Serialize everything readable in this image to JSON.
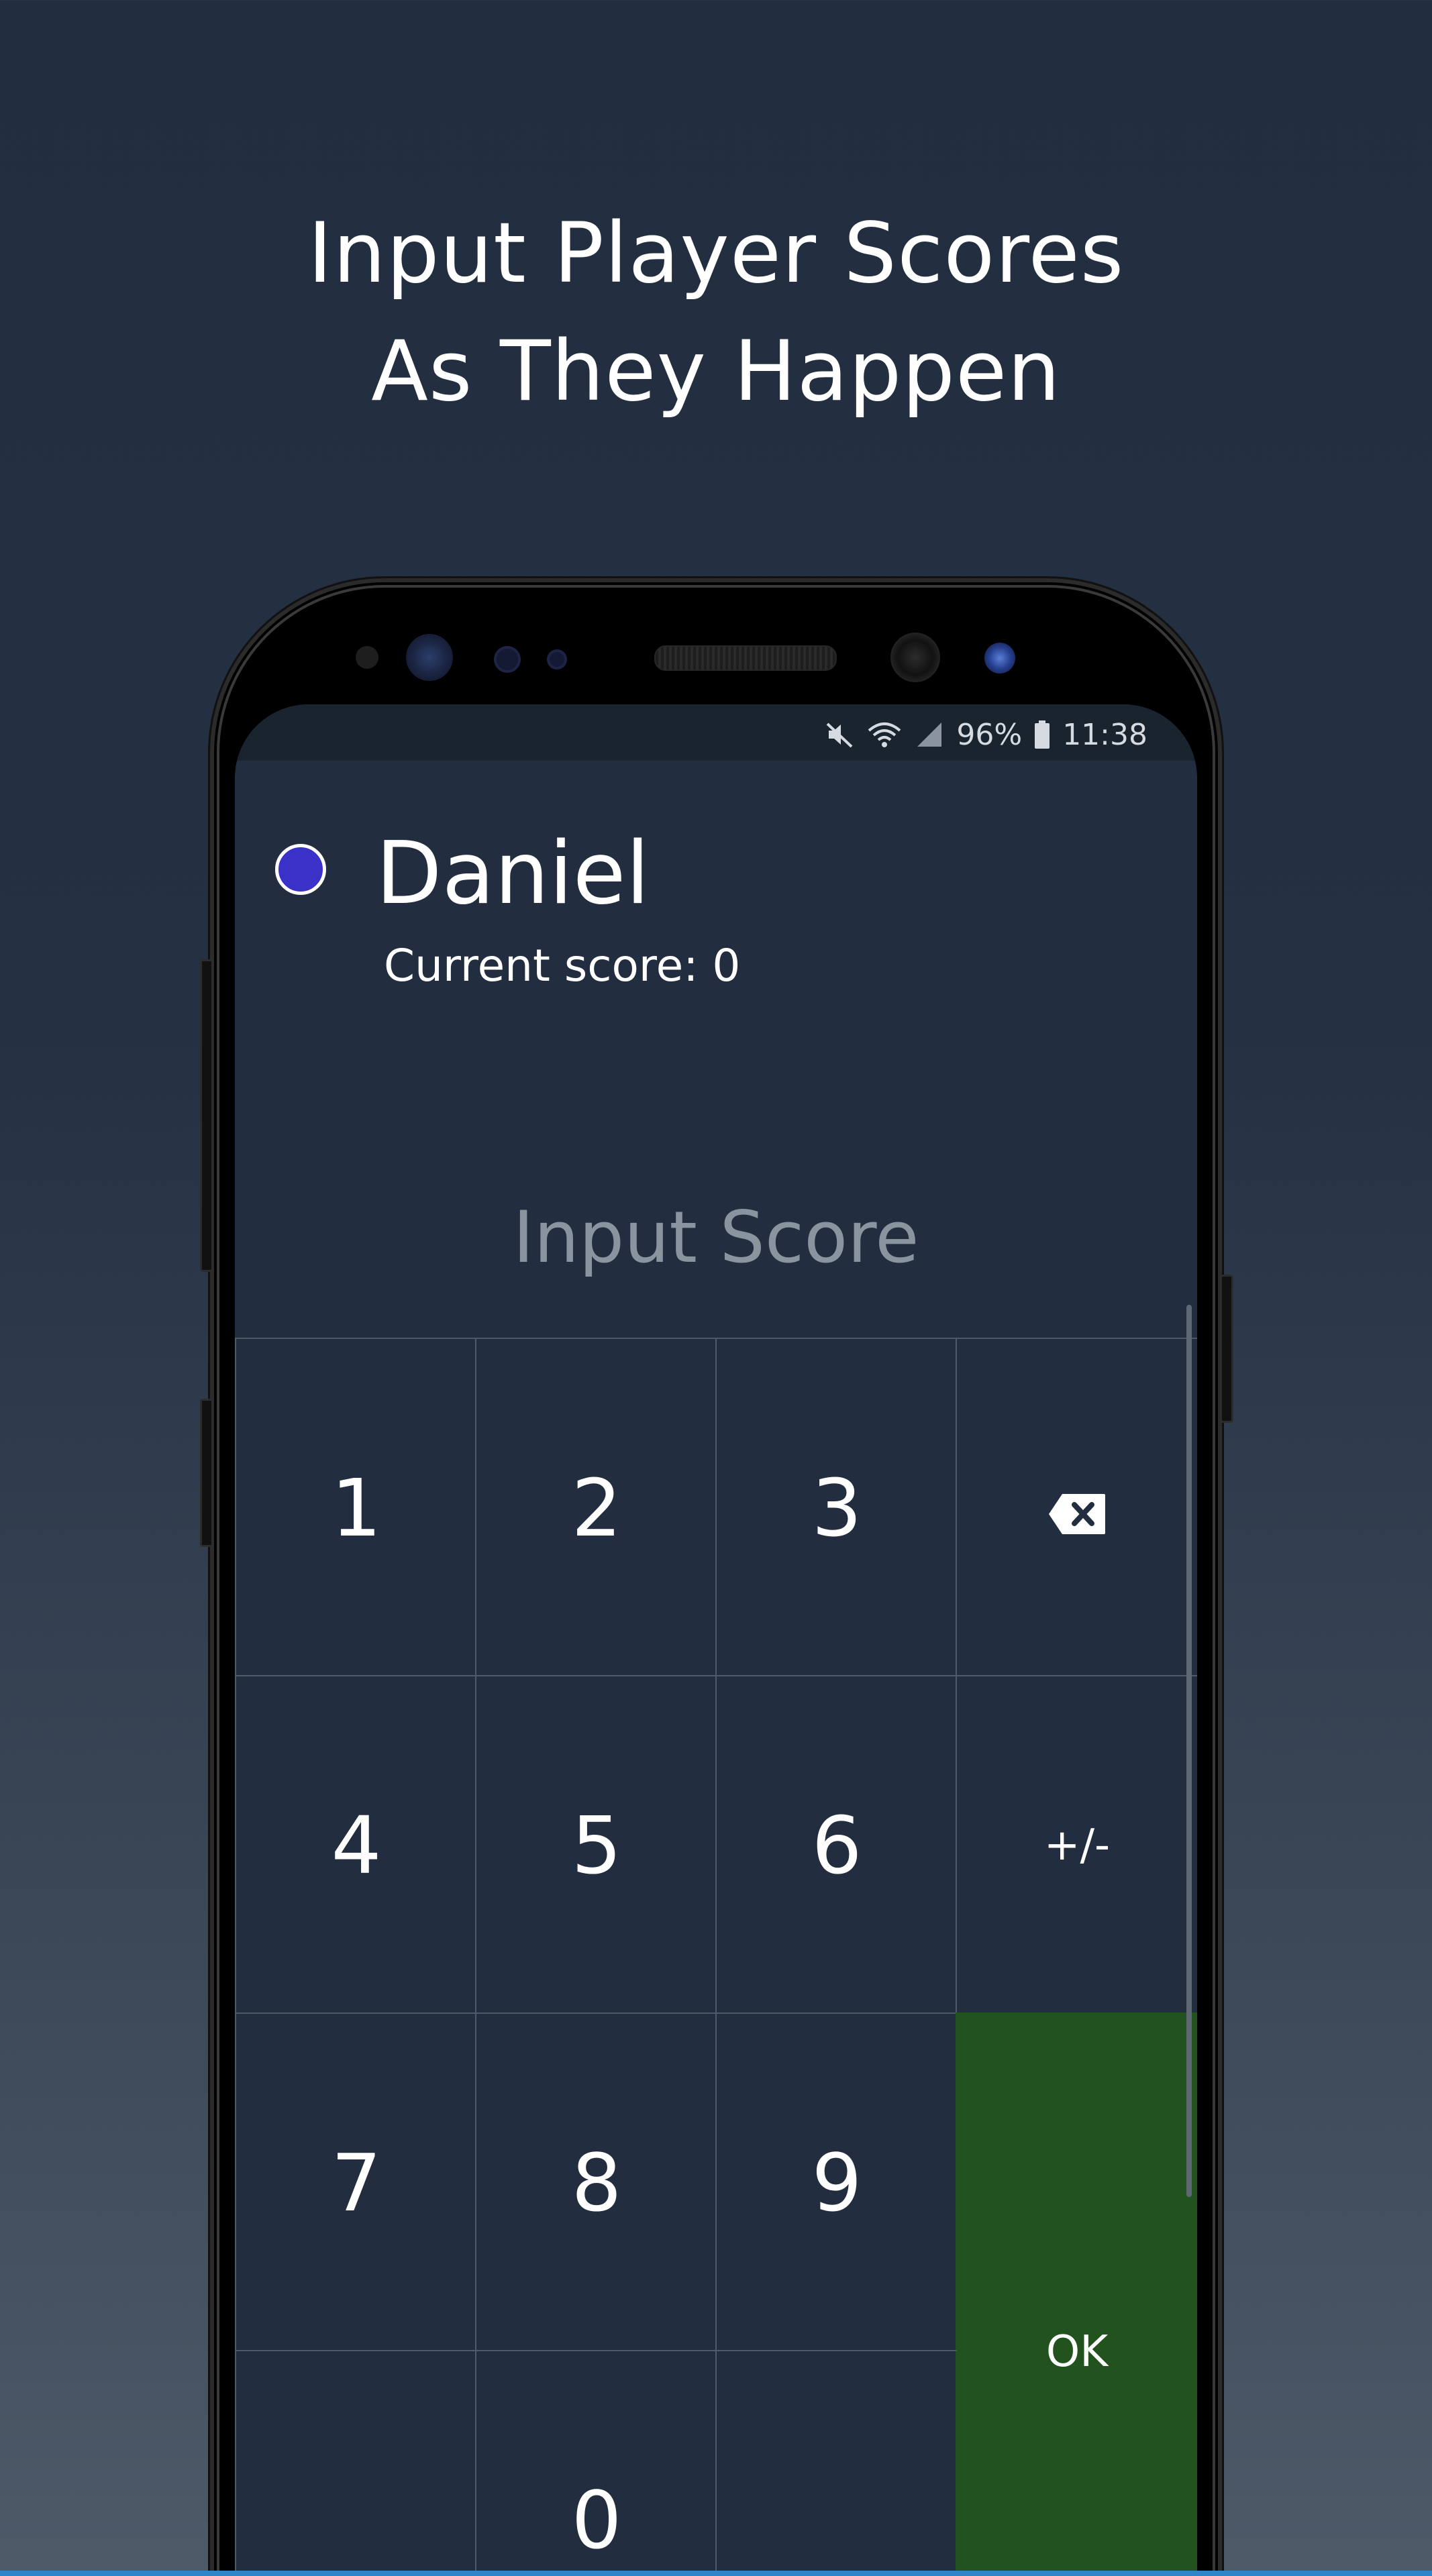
{
  "promo": {
    "title_line1": "Input Player Scores",
    "title_line2": "As They Happen"
  },
  "status_bar": {
    "icons": [
      "mute-icon",
      "wifi-icon",
      "signal-icon",
      "battery-icon"
    ],
    "battery_percent": "96%",
    "time": "11:38"
  },
  "player": {
    "name": "Daniel",
    "color": "#3a31c8",
    "current_score_text": "Current score: 0"
  },
  "score_input": {
    "placeholder": "Input Score"
  },
  "keypad": {
    "keys": {
      "one": "1",
      "two": "2",
      "three": "3",
      "four": "4",
      "five": "5",
      "six": "6",
      "seven": "7",
      "eight": "8",
      "nine": "9",
      "zero": "0",
      "sign": "+/-",
      "ok": "OK"
    },
    "backspace_icon": "backspace-icon",
    "ok_color": "#22531f"
  }
}
